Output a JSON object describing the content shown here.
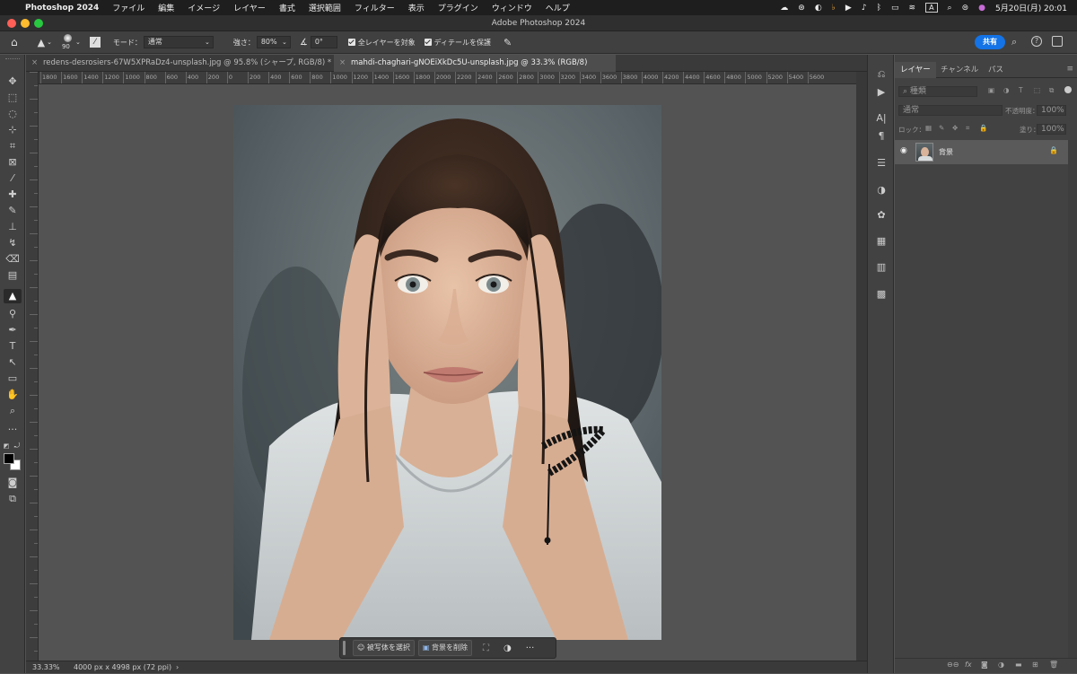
{
  "menubar": {
    "app_name": "Photoshop 2024",
    "items": [
      "ファイル",
      "編集",
      "イメージ",
      "レイヤー",
      "書式",
      "選択範囲",
      "フィルター",
      "表示",
      "プラグイン",
      "ウィンドウ",
      "ヘルプ"
    ],
    "input_mode": "A",
    "clock": "5月20日(月)  20:01"
  },
  "titlebar": {
    "title": "Adobe Photoshop 2024"
  },
  "options": {
    "brush_size": "90",
    "mode_label": "モード：",
    "mode_value": "通常",
    "strength_label": "強さ：",
    "strength_value": "80%",
    "angle_value": "0°",
    "sample_all_layers": "全レイヤーを対象",
    "protect_detail": "ディテールを保護",
    "share_label": "共有"
  },
  "tabs": [
    {
      "label": "redens-desrosiers-67W5XPRaDz4-unsplash.jpg @ 95.8% (シャープ, RGB/8) *",
      "active": false
    },
    {
      "label": "mahdi-chaghari-gNOEiXkDc5U-unsplash.jpg @ 33.3% (RGB/8)",
      "active": true
    }
  ],
  "ruler": {
    "h_labels": [
      "1800",
      "1600",
      "1400",
      "1200",
      "1000",
      "800",
      "600",
      "400",
      "200",
      "0",
      "200",
      "400",
      "600",
      "800",
      "1000",
      "1200",
      "1400",
      "1600",
      "1800",
      "2000",
      "2200",
      "2400",
      "2600",
      "2800",
      "3000",
      "3200",
      "3400",
      "3600",
      "3800",
      "4000",
      "4200",
      "4400",
      "4600",
      "4800",
      "5000",
      "5200",
      "5400",
      "5600"
    ]
  },
  "context_bar": {
    "select_subject": "被写体を選択",
    "remove_background": "背景を削除",
    "more": "···"
  },
  "status": {
    "zoom": "33.33%",
    "doc_info": "4000 px x 4998 px (72 ppi)",
    "arrow": "›"
  },
  "panel": {
    "tabs": [
      "レイヤー",
      "チャンネル",
      "パス"
    ],
    "kind_placeholder": "種類",
    "blend_mode": "通常",
    "opacity_label": "不透明度：",
    "opacity_value": "100%",
    "lock_label": "ロック：",
    "fill_label": "塗り：",
    "fill_value": "100%",
    "layer_name": "背景"
  },
  "colors": {
    "accent": "#1473e6",
    "bg": "#535353",
    "panel": "#424242"
  }
}
